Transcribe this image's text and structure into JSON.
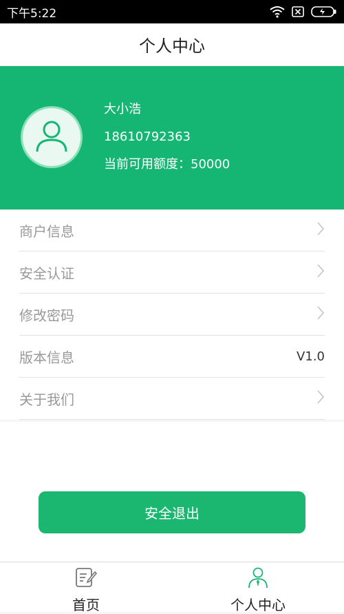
{
  "status_bar": {
    "time": "下午5:22",
    "icons": [
      "wifi-icon",
      "no-sim-icon",
      "battery-charging-icon"
    ]
  },
  "header": {
    "title": "个人中心"
  },
  "profile": {
    "avatar_icon": "user-icon",
    "name": "大小浩",
    "phone": "18610792363",
    "credit": "当前可用额度：50000"
  },
  "menu": {
    "items": [
      {
        "label": "商户信息",
        "icon": "chevron-right-icon"
      },
      {
        "label": "安全认证",
        "icon": "chevron-right-icon"
      },
      {
        "label": "修改密码",
        "icon": "chevron-right-icon"
      },
      {
        "label": "版本信息",
        "value": "V1.0"
      },
      {
        "label": "关于我们",
        "icon": "chevron-right-icon"
      }
    ]
  },
  "logout": {
    "label": "安全退出"
  },
  "tabs": [
    {
      "label": "首页",
      "icon": "edit-note-icon"
    },
    {
      "label": "个人中心",
      "icon": "user-tie-icon"
    }
  ],
  "colors": {
    "accent": "#15b573",
    "button": "#1bb66f"
  }
}
